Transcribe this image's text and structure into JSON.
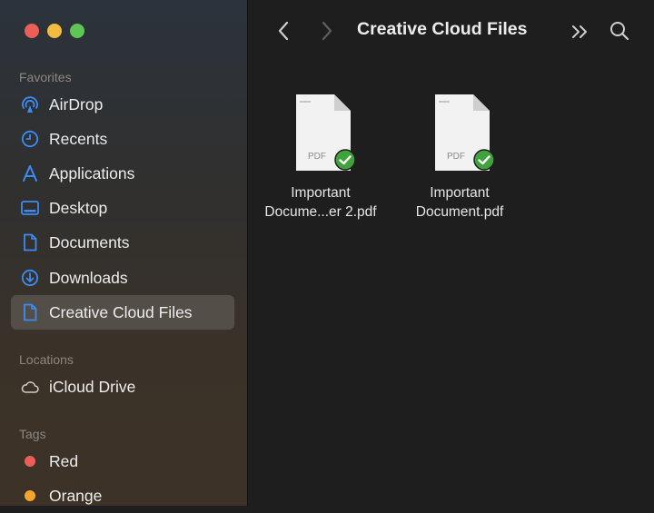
{
  "sidebar": {
    "favorites_label": "Favorites",
    "favorites": [
      {
        "label": "AirDrop",
        "icon": "airdrop-icon"
      },
      {
        "label": "Recents",
        "icon": "clock-icon"
      },
      {
        "label": "Applications",
        "icon": "applications-icon"
      },
      {
        "label": "Desktop",
        "icon": "desktop-icon"
      },
      {
        "label": "Documents",
        "icon": "document-icon"
      },
      {
        "label": "Downloads",
        "icon": "download-icon"
      },
      {
        "label": "Creative Cloud Files",
        "icon": "file-icon",
        "selected": true
      }
    ],
    "locations_label": "Locations",
    "locations": [
      {
        "label": "iCloud Drive",
        "icon": "cloud-icon"
      }
    ],
    "tags_label": "Tags",
    "tags": [
      {
        "label": "Red",
        "color": "#ec5f59"
      },
      {
        "label": "Orange",
        "color": "#f4a32c"
      }
    ]
  },
  "toolbar": {
    "title": "Creative Cloud Files"
  },
  "files": [
    {
      "name_line1": "Important",
      "name_line2": "Docume...er 2.pdf",
      "type_label": "PDF",
      "synced": true
    },
    {
      "name_line1": "Important",
      "name_line2": "Document.pdf",
      "type_label": "PDF",
      "synced": true
    }
  ],
  "colors": {
    "accent_blue": "#3b8cf4",
    "sync_green": "#3fa33c"
  }
}
